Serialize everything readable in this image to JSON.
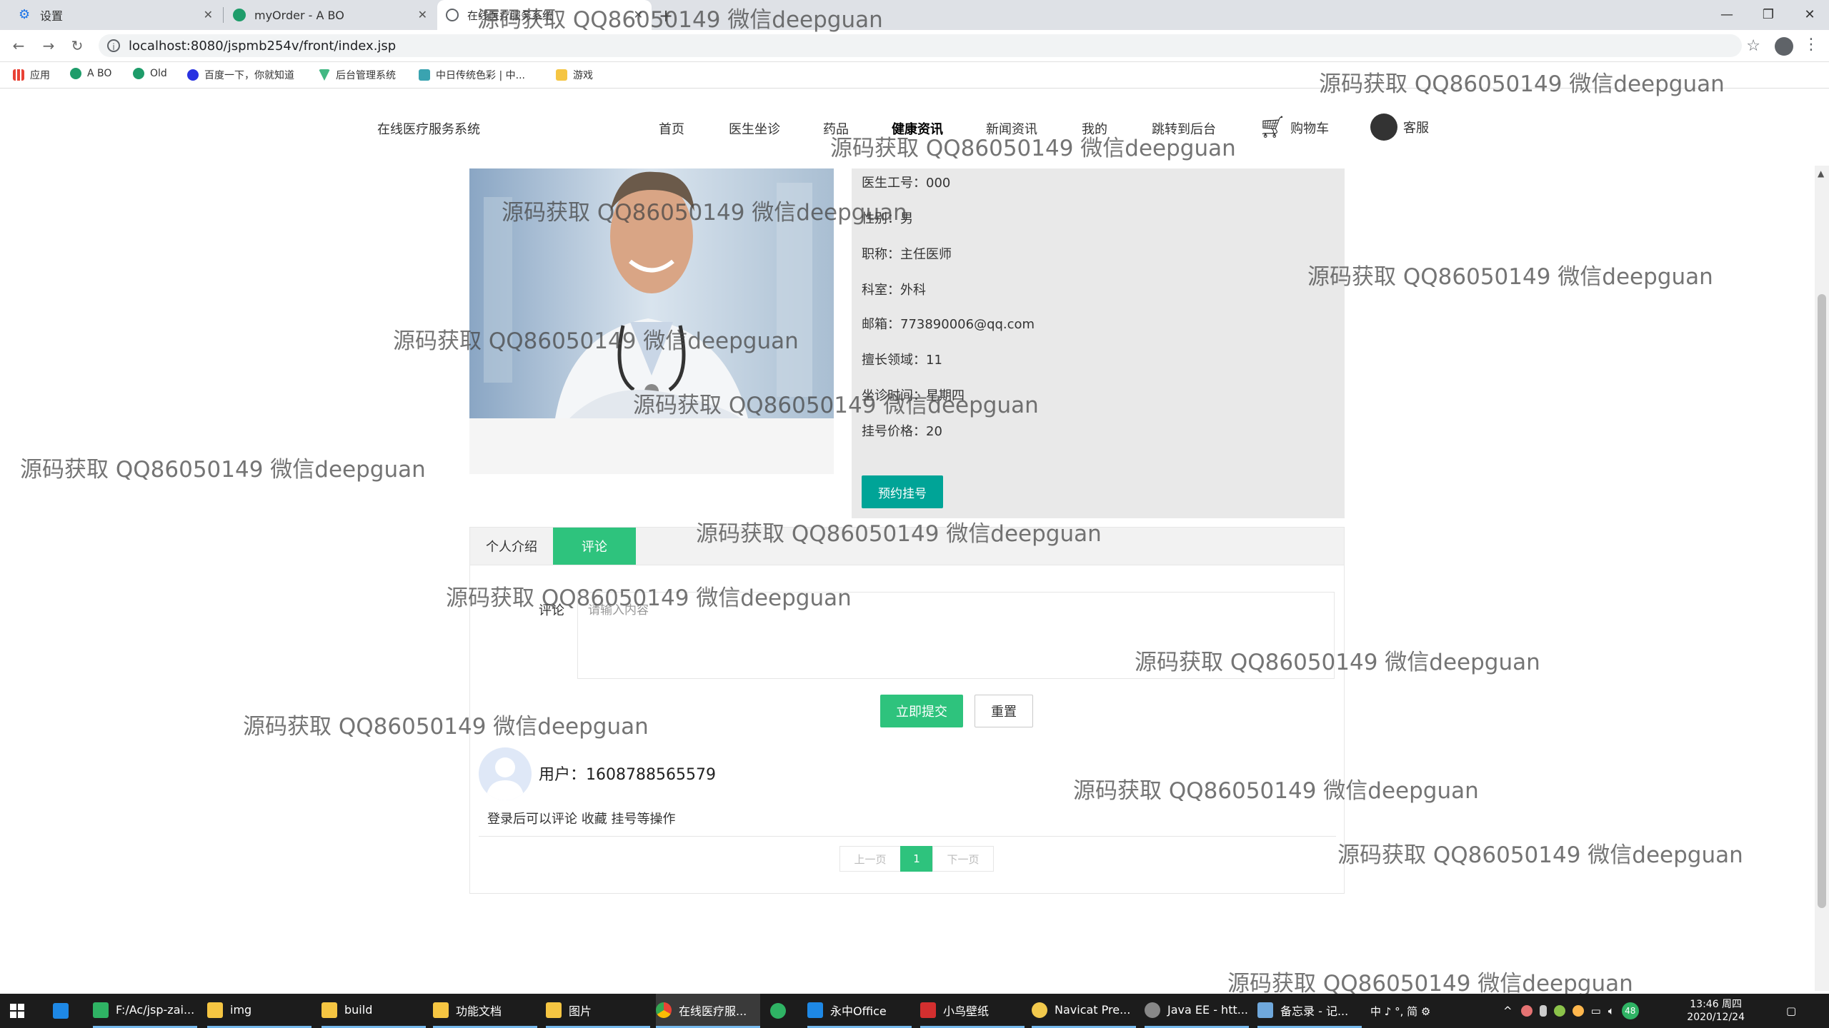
{
  "browser": {
    "tabs": [
      {
        "title": "设置"
      },
      {
        "title": "myOrder - A BO"
      },
      {
        "title": "在线医疗服务系统"
      }
    ],
    "new_tab": "+",
    "url": "localhost:8080/jspmb254v/front/index.jsp",
    "bookmarks": [
      "应用",
      "A BO",
      "Old",
      "百度一下，你就知道",
      "后台管理系统",
      "中日传统色彩 | 中...",
      "游戏"
    ]
  },
  "nav": {
    "logo": "在线医疗服务系统",
    "items": [
      "首页",
      "医生坐诊",
      "药品",
      "健康资讯",
      "新闻资讯",
      "我的",
      "跳转到后台"
    ],
    "cart": "购物车",
    "service": "客服"
  },
  "doctor": {
    "fields": [
      {
        "label": "医生工号：",
        "value": "000"
      },
      {
        "label": "性别：",
        "value": "男"
      },
      {
        "label": "职称：",
        "value": "主任医师"
      },
      {
        "label": "科室：",
        "value": "外科"
      },
      {
        "label": "邮箱：",
        "value": "773890006@qq.com"
      },
      {
        "label": "擅长领域：",
        "value": "11"
      },
      {
        "label": "坐诊时间：",
        "value": "星期四"
      },
      {
        "label": "挂号价格：",
        "value": "20"
      }
    ],
    "book_button": "预约挂号"
  },
  "comments": {
    "tabs": [
      "个人介绍",
      "评论"
    ],
    "form_label": "评论",
    "placeholder": "请输入内容",
    "submit": "立即提交",
    "reset": "重置",
    "user_line": "用户：1608788565579",
    "login_tip": "登录后可以评论 收藏 挂号等操作",
    "pager": {
      "prev": "上一页",
      "current": "1",
      "next": "下一页"
    }
  },
  "watermark": "源码获取 QQ86050149 微信deepguan",
  "taskbar": {
    "items": [
      "F:/Ac/jsp-zai...",
      "img",
      "build",
      "功能文档",
      "图片",
      "在线医疗服...",
      "",
      "永中Office",
      "小鸟壁纸",
      "Navicat Pre...",
      "Java EE - htt...",
      "备忘录 - 记..."
    ],
    "ime": "中 ♪ °, 简 ⚙",
    "badge": "48",
    "time": "13:46 周四",
    "date": "2020/12/24"
  },
  "colors": {
    "accent_green": "#2ec37d",
    "teal": "#00a497",
    "info_bg": "#e9e9e9"
  }
}
